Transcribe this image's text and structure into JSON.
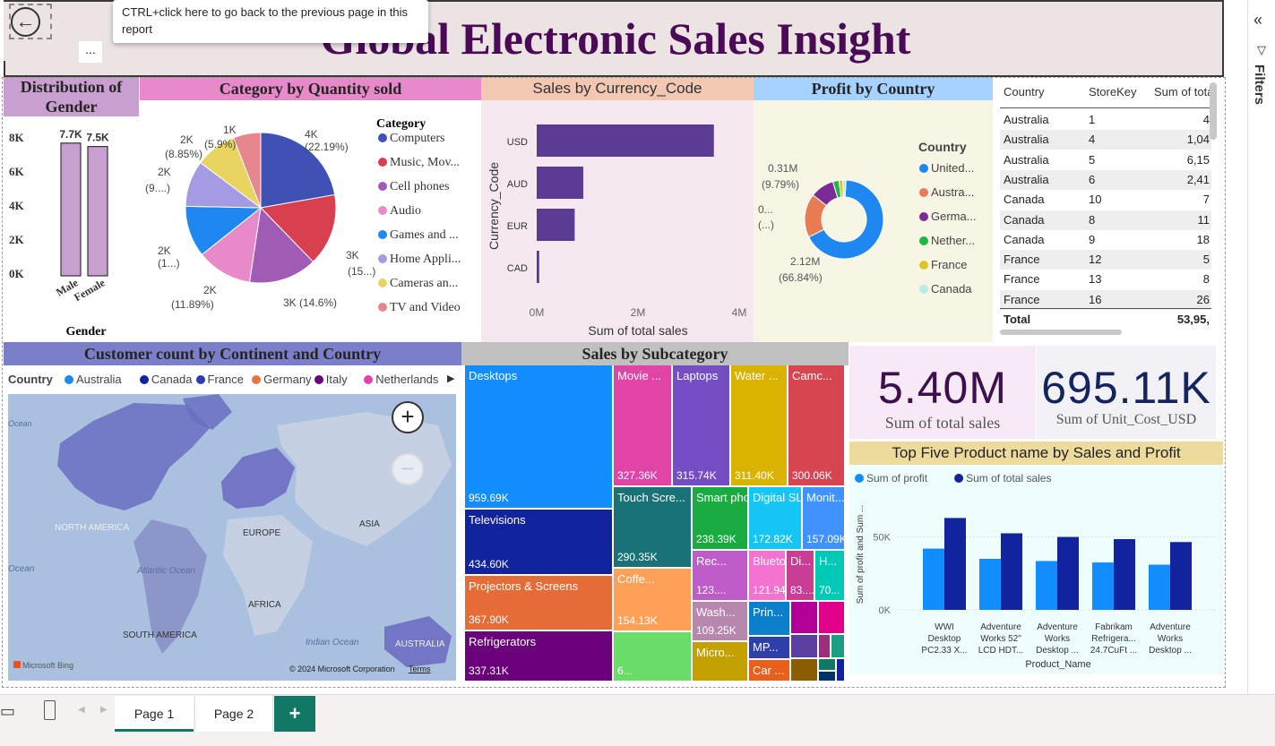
{
  "report": {
    "title": "Global Electronic Sales Insight",
    "back_tooltip": "CTRL+click here to go back to the previous page in this report",
    "more_label": "...",
    "filters_label": "Filters"
  },
  "gender_chart": {
    "title": "Distribution of Gender",
    "xlabel": "Gender",
    "yticks": [
      "8K",
      "6K",
      "4K",
      "2K",
      "0K"
    ],
    "categories": [
      "Male",
      "Female"
    ],
    "data_labels": [
      "7.7K",
      "7.5K"
    ],
    "values": [
      7700,
      7500
    ],
    "ylim": [
      0,
      8000
    ],
    "bar_color": "#c7a0cf"
  },
  "category_chart": {
    "title": "Category by Quantity sold",
    "legend_title": "Category",
    "legend": [
      "Computers",
      "Music, Mov...",
      "Cell phones",
      "Audio",
      "Games and ...",
      "Home Appli...",
      "Cameras an...",
      "TV and Video"
    ],
    "colors": [
      "#3f51b5",
      "#d9404f",
      "#a05bb4",
      "#e88ac9",
      "#1e88f0",
      "#a59be2",
      "#e8d461",
      "#e8868f"
    ],
    "labels": [
      "4K",
      "(22.19%)",
      "3K",
      "(15...)",
      "3K (14.6%)",
      "2K",
      "(11.89%)",
      "2K",
      "(1...)",
      "2K",
      "(9....)",
      "2K",
      "(8.85%)",
      "1K",
      "(5.9%)"
    ],
    "values": [
      22.19,
      15.5,
      14.6,
      11.89,
      11.0,
      9.9,
      8.85,
      5.9
    ]
  },
  "currency_chart": {
    "title": "Sales by Currency_Code",
    "ylabel": "Currency_Code",
    "xlabel": "Sum of total sales",
    "categories": [
      "USD",
      "AUD",
      "EUR",
      "CAD"
    ],
    "values": [
      3.5,
      0.92,
      0.75,
      0.05
    ],
    "xticks": [
      "0M",
      "2M",
      "4M"
    ],
    "xlim": [
      0,
      4
    ],
    "bar_color": "#5c3b94"
  },
  "profit_chart": {
    "title": "Profit by Country",
    "legend_title": "Country",
    "legend": [
      "United...",
      "Austra...",
      "Germa...",
      "Nether...",
      "France",
      "Canada"
    ],
    "colors": [
      "#1e88f0",
      "#e87c52",
      "#7b2a96",
      "#1fb843",
      "#e0c32a",
      "#b6ece4"
    ],
    "values": [
      66.84,
      18.0,
      9.79,
      2.5,
      1.6,
      1.27
    ],
    "labels": [
      "0.31M",
      "(9.79%)",
      "0...",
      "(...)",
      "2.12M",
      "(66.84%)"
    ]
  },
  "store_table": {
    "headers": [
      "Country",
      "StoreKey",
      "Sum of tota"
    ],
    "rows": [
      [
        "Australia",
        "1",
        "4"
      ],
      [
        "Australia",
        "4",
        "1,04"
      ],
      [
        "Australia",
        "5",
        "6,15"
      ],
      [
        "Australia",
        "6",
        "2,41"
      ],
      [
        "Canada",
        "10",
        "7"
      ],
      [
        "Canada",
        "8",
        "11"
      ],
      [
        "Canada",
        "9",
        "18"
      ],
      [
        "France",
        "12",
        "5"
      ],
      [
        "France",
        "13",
        "8"
      ],
      [
        "France",
        "16",
        "26"
      ]
    ],
    "total_label": "Total",
    "total_value": "53,95,"
  },
  "map_chart": {
    "title": "Customer count by Continent and Country",
    "legend_title": "Country",
    "legend": [
      "Australia",
      "Canada",
      "France",
      "Germany",
      "Italy",
      "Netherlands"
    ],
    "legend_colors": [
      "#1e88f0",
      "#12239e",
      "#2a3ab8",
      "#e8743b",
      "#6b007b",
      "#e044a7"
    ],
    "labels": [
      "Ocean",
      "NORTH AMERICA",
      "EUROPE",
      "ASIA",
      "Ocean",
      "Atlantic Ocean",
      "AFRICA",
      "SOUTH AMERICA",
      "Indian Ocean",
      "AUSTRALIA"
    ],
    "bing": "Microsoft Bing",
    "copyright": "© 2024 Microsoft Corporation",
    "terms": "Terms",
    "zoom_in": "+",
    "zoom_out": "−"
  },
  "subcategory_chart": {
    "title": "Sales by Subcategory",
    "items": [
      {
        "name": "Desktops",
        "value": "959.69K",
        "color": "#118dff"
      },
      {
        "name": "Televisions",
        "value": "434.60K",
        "color": "#12239e"
      },
      {
        "name": "Projectors & Screens",
        "value": "367.90K",
        "color": "#e66c37"
      },
      {
        "name": "Refrigerators",
        "value": "337.31K",
        "color": "#6b007b"
      },
      {
        "name": "Movie ...",
        "value": "327.36K",
        "color": "#e044a7"
      },
      {
        "name": "Laptops",
        "value": "315.74K",
        "color": "#744ec2"
      },
      {
        "name": "Water ...",
        "value": "311.40K",
        "color": "#d9b300"
      },
      {
        "name": "Camc...",
        "value": "300.06K",
        "color": "#d64550"
      },
      {
        "name": "Touch Scre...",
        "value": "290.35K",
        "color": "#197278"
      },
      {
        "name": "Smart pho...",
        "value": "238.39K",
        "color": "#1aab40"
      },
      {
        "name": "Digital SLR...",
        "value": "172.82K",
        "color": "#15c6f4"
      },
      {
        "name": "Monit...",
        "value": "157.09K",
        "color": "#4092ff"
      },
      {
        "name": "Coffe...",
        "value": "154.13K",
        "color": "#ffa058"
      },
      {
        "name": "Rec...",
        "value": "123....",
        "color": "#be5dc9"
      },
      {
        "name": "Blueto...",
        "value": "121.94K",
        "color": "#f472d0"
      },
      {
        "name": "Di...",
        "value": "83....",
        "color": "#c83d95"
      },
      {
        "name": "H...",
        "value": "70...",
        "color": "#00c9b6"
      },
      {
        "name": "",
        "value": "6...",
        "color": "#6adc68"
      },
      {
        "name": "Wash...",
        "value": "109.25K",
        "color": "#b887ad"
      },
      {
        "name": "Prin...",
        "value": "",
        "color": "#0b7fc9"
      },
      {
        "name": "MP...",
        "value": "",
        "color": "#2d3fa8"
      },
      {
        "name": "Micro...",
        "value": "",
        "color": "#c2a100"
      },
      {
        "name": "Car ...",
        "value": "",
        "color": "#e95f1c"
      }
    ]
  },
  "kpi": {
    "sales_value": "5.40M",
    "sales_label": "Sum of total sales",
    "cost_value": "695.11K",
    "cost_label": "Sum of Unit_Cost_USD"
  },
  "top5_chart": {
    "title": "Top Five Product name by Sales and Profit",
    "xlabel": "Product_Name",
    "ylabel": "Sum of profit and Sum ...",
    "yticks": [
      "50K",
      "0K"
    ],
    "ylim": [
      0,
      70000
    ],
    "series": [
      {
        "name": "Sum of profit",
        "color": "#118dff",
        "values": [
          42000,
          35000,
          33500,
          32500,
          31000
        ]
      },
      {
        "name": "Sum of total sales",
        "color": "#12239e",
        "values": [
          63000,
          52500,
          50000,
          48500,
          46500
        ]
      }
    ],
    "categories": [
      [
        "WWI",
        "Desktop",
        "PC2.33 X..."
      ],
      [
        "Adventure",
        "Works 52\"",
        "LCD HDT..."
      ],
      [
        "Adventure",
        "Works",
        "Desktop ..."
      ],
      [
        "Fabrikam",
        "Refrigera...",
        "24.7CuFt ..."
      ],
      [
        "Adventure",
        "Works",
        "Desktop ..."
      ]
    ]
  },
  "pages": {
    "tabs": [
      "Page 1",
      "Page 2"
    ],
    "add": "+"
  }
}
